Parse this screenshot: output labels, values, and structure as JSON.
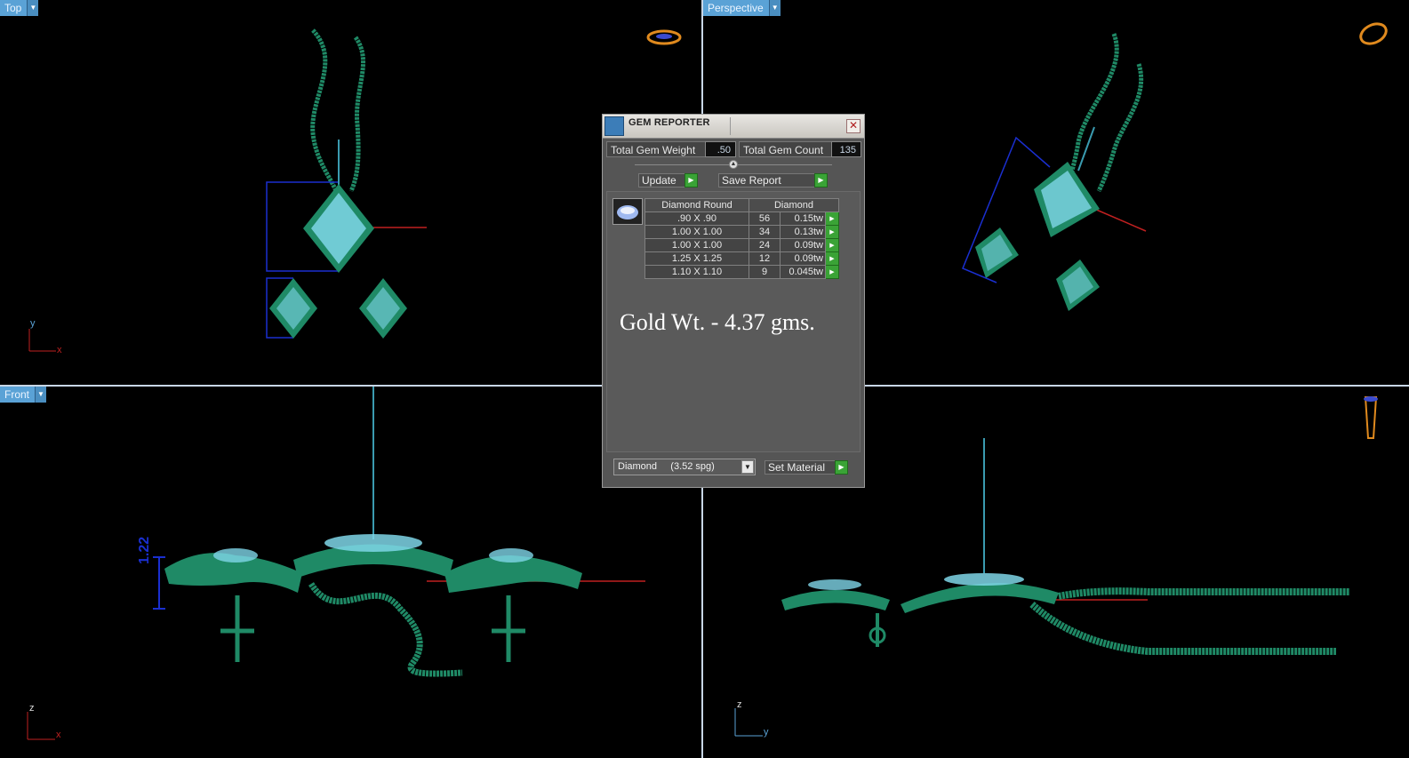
{
  "viewports": {
    "top": {
      "label": "Top",
      "axis_a": "y",
      "axis_b": "x"
    },
    "perspective": {
      "label": "Perspective"
    },
    "front": {
      "label": "Front",
      "axis_a": "z",
      "axis_b": "x",
      "dimension": "1.22"
    },
    "right": {
      "axis_a": "z",
      "axis_b": "y"
    }
  },
  "dialog": {
    "title": "GEM REPORTER",
    "total_gem_weight_label": "Total Gem Weight",
    "total_gem_weight_value": ".50",
    "total_gem_count_label": "Total Gem Count",
    "total_gem_count_value": "135",
    "update_label": "Update",
    "save_report_label": "Save Report",
    "table": {
      "col_shape": "Diamond Round",
      "col_material": "Diamond",
      "rows": [
        {
          "size": ".90 X .90",
          "count": "56",
          "weight": "0.15tw"
        },
        {
          "size": "1.00 X 1.00",
          "count": "34",
          "weight": "0.13tw"
        },
        {
          "size": "1.00 X 1.00",
          "count": "24",
          "weight": "0.09tw"
        },
        {
          "size": "1.25 X 1.25",
          "count": "12",
          "weight": "0.09tw"
        },
        {
          "size": "1.10 X 1.10",
          "count": "9",
          "weight": "0.045tw"
        }
      ]
    },
    "gold_weight": "Gold Wt. - 4.37 gms.",
    "material_select": "Diamond     (3.52 spg)",
    "set_material_label": "Set Material"
  },
  "colors": {
    "background": "#000000",
    "metal": "#1f8a66",
    "gem": "#7fd6e8",
    "dimension": "#1a2fd0",
    "axis_x": "#c02020",
    "viewport_label": "#5aa2d6"
  }
}
